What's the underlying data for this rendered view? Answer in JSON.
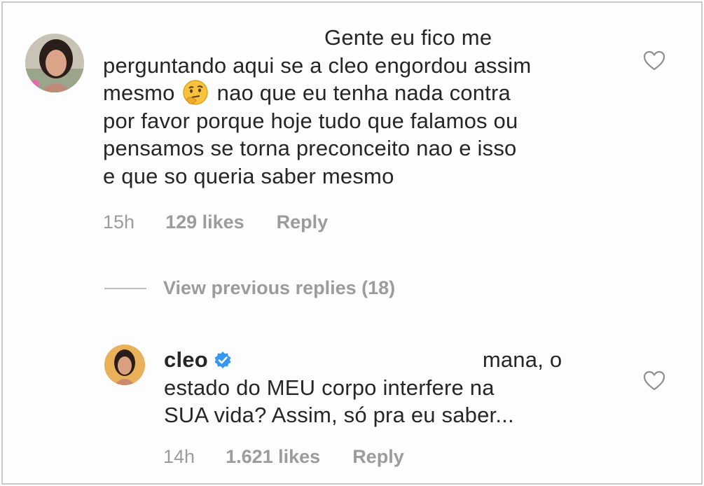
{
  "comments": [
    {
      "lines": [
        "Gente eu fico me",
        "perguntando aqui se a cleo engordou assim",
        "mesmo",
        "nao que eu tenha nada contra",
        "por favor porque hoje tudo que falamos ou",
        "pensamos se torna preconceito nao e isso",
        "e que so queria saber mesmo"
      ],
      "emoji": "thinking-face-emoji",
      "time": "15h",
      "likes": "129 likes",
      "reply_label": "Reply"
    },
    {
      "username": "cleo",
      "verified": true,
      "lines": [
        "mana, o",
        "estado do MEU corpo interfere na",
        "SUA vida? Assim, só pra eu saber..."
      ],
      "time": "14h",
      "likes": "1.621 likes",
      "reply_label": "Reply"
    }
  ],
  "view_replies": {
    "label": "View previous replies (18)"
  },
  "colors": {
    "text": "#262626",
    "meta": "#9c9c9c",
    "verified_badge": "#3897f0",
    "border": "#c9c9c9"
  },
  "icons": [
    "heart-outline-icon",
    "verified-badge-icon"
  ]
}
